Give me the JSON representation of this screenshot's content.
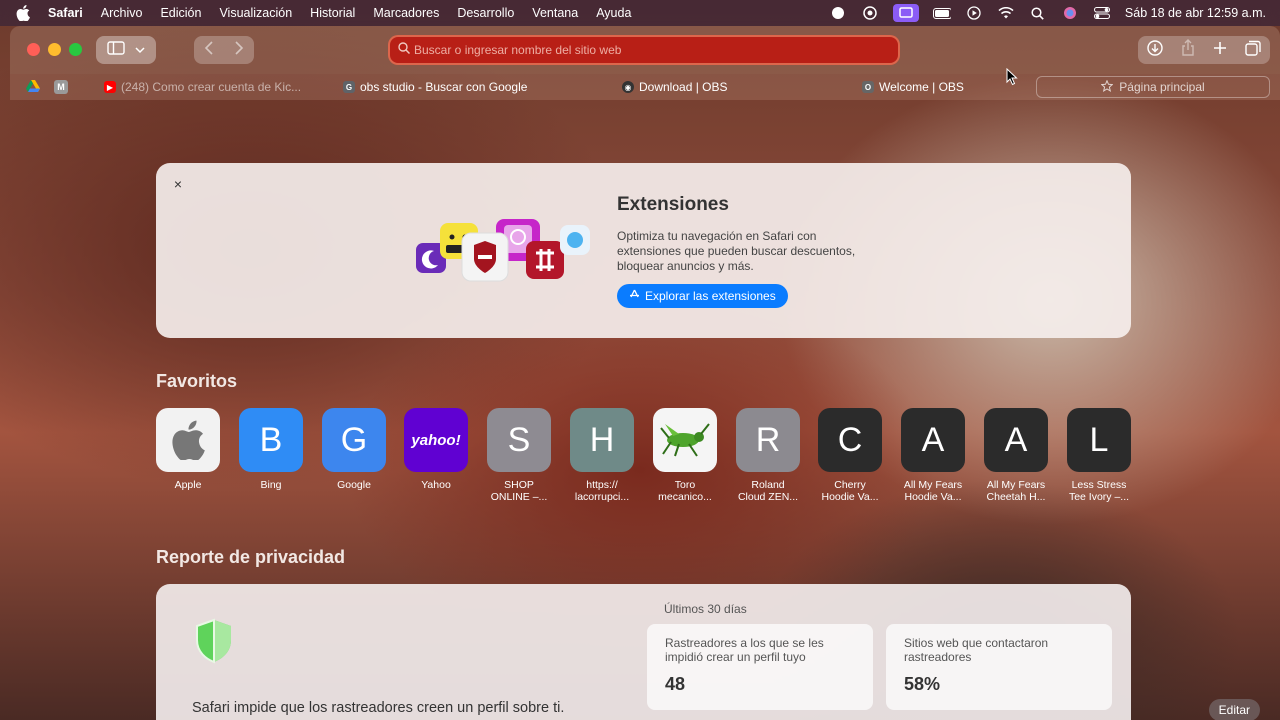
{
  "menubar": {
    "app": "Safari",
    "items": [
      "Archivo",
      "Edición",
      "Visualización",
      "Historial",
      "Marcadores",
      "Desarrollo",
      "Ventana",
      "Ayuda"
    ],
    "clock": "Sáb 18 de abr  12:59 a.m."
  },
  "toolbar": {
    "address_placeholder": "Buscar o ingresar nombre del sitio web"
  },
  "favbar": {
    "tabs": [
      {
        "label": "(248) Como crear cuenta de Kic...",
        "icon": "youtube-icon",
        "color": "#ff0000"
      },
      {
        "label": "obs studio - Buscar con Google",
        "icon": "google-icon",
        "color": "#5f6368"
      },
      {
        "label": "Download | OBS",
        "icon": "obs-icon",
        "color": "#333333"
      },
      {
        "label": "Welcome | OBS",
        "icon": "obs-icon",
        "color": "#666666"
      }
    ],
    "homepage": "Página principal"
  },
  "extensions": {
    "title": "Extensiones",
    "description": "Optimiza tu navegación en Safari con extensiones que pueden buscar descuentos, bloquear anuncios y más.",
    "button": "Explorar las extensiones",
    "close": "×"
  },
  "favorites": {
    "title": "Favoritos",
    "items": [
      {
        "letter": "",
        "label": "Apple",
        "bg": "#f2f2f2",
        "icon": "apple-icon"
      },
      {
        "letter": "B",
        "label": "Bing",
        "bg": "#2f8cf5"
      },
      {
        "letter": "G",
        "label": "Google",
        "bg": "#3d86ee"
      },
      {
        "letter": "yahoo!",
        "label": "Yahoo",
        "bg": "#6001d2"
      },
      {
        "letter": "S",
        "label": "SHOP\nONLINE –...",
        "bg": "#8e8b92"
      },
      {
        "letter": "H",
        "label": "https://\nlacorrupci...",
        "bg": "#6f8a88"
      },
      {
        "letter": "",
        "label": "Toro\nmecanico...",
        "bg": "#f5f5f5",
        "icon": "grasshopper-icon"
      },
      {
        "letter": "R",
        "label": "Roland\nCloud ZEN...",
        "bg": "#8c8a90"
      },
      {
        "letter": "C",
        "label": "Cherry\nHoodie Va...",
        "bg": "#2b2b2b"
      },
      {
        "letter": "A",
        "label": "All My Fears\nHoodie Va...",
        "bg": "#2b2b2b"
      },
      {
        "letter": "A",
        "label": "All My Fears\nCheetah H...",
        "bg": "#2b2b2b"
      },
      {
        "letter": "L",
        "label": "Less Stress\nTee Ivory –...",
        "bg": "#2b2b2b"
      }
    ]
  },
  "privacy": {
    "title": "Reporte de privacidad",
    "period": "Últimos 30 días",
    "text": "Safari impide que los rastreadores creen un perfil sobre ti.",
    "stats": [
      {
        "label": "Rastreadores a los que se les impidió crear un perfil tuyo",
        "value": "48"
      },
      {
        "label": "Sitios web que contactaron rastreadores",
        "value": "58%"
      }
    ]
  },
  "edit_button": "Editar"
}
